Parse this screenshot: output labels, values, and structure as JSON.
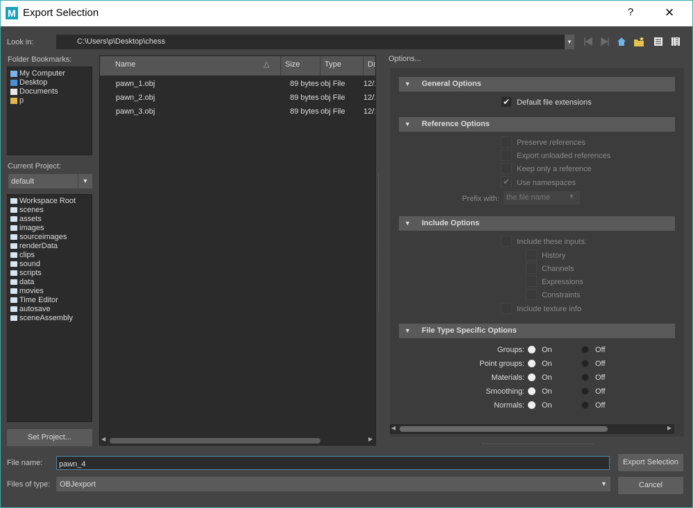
{
  "window": {
    "title": "Export Selection",
    "help": "?",
    "close": "×"
  },
  "lookin": {
    "label": "Look in:",
    "path": "C:\\Users\\p\\Desktop\\chess"
  },
  "bookmarks": {
    "label": "Folder Bookmarks:",
    "items": [
      "My Computer",
      "Desktop",
      "Documents",
      "p"
    ]
  },
  "project": {
    "label": "Current Project:",
    "value": "default",
    "set_button": "Set Project..."
  },
  "workspace": {
    "items": [
      "Workspace Root",
      "scenes",
      "assets",
      "images",
      "sourceimages",
      "renderData",
      "clips",
      "sound",
      "scripts",
      "data",
      "movies",
      "Time Editor",
      "autosave",
      "sceneAssembly"
    ]
  },
  "filelist": {
    "headers": {
      "name": "Name",
      "size": "Size",
      "type": "Type",
      "date": "Da"
    },
    "rows": [
      {
        "name": "pawn_1.obj",
        "size": "89 bytes",
        "type": "obj File",
        "date": "12/1"
      },
      {
        "name": "pawn_2.obj",
        "size": "89 bytes",
        "type": "obj File",
        "date": "12/1"
      },
      {
        "name": "pawn_3.obj",
        "size": "89 bytes",
        "type": "obj File",
        "date": "12/1"
      }
    ]
  },
  "options": {
    "title": "Options...",
    "general": {
      "title": "General Options",
      "default_ext": "Default file extensions"
    },
    "reference": {
      "title": "Reference Options",
      "preserve": "Preserve references",
      "export_unloaded": "Export unloaded references",
      "keep_only": "Keep only a reference",
      "use_namespaces": "Use namespaces",
      "prefix_label": "Prefix with:",
      "prefix_value": "the file name"
    },
    "include": {
      "title": "Include Options",
      "include_inputs": "Include these inputs:",
      "history": "History",
      "channels": "Channels",
      "expressions": "Expressions",
      "constraints": "Constraints",
      "texture_info": "Include texture info"
    },
    "filetype": {
      "title": "File Type Specific Options",
      "on": "On",
      "off": "Off",
      "rows": [
        "Groups:",
        "Point groups:",
        "Materials:",
        "Smoothing:",
        "Normals:"
      ]
    }
  },
  "bottom": {
    "filename_label": "File name:",
    "filename_value": "pawn_4",
    "filetype_label": "Files of type:",
    "filetype_value": "OBJexport",
    "export_button": "Export Selection",
    "cancel_button": "Cancel"
  }
}
